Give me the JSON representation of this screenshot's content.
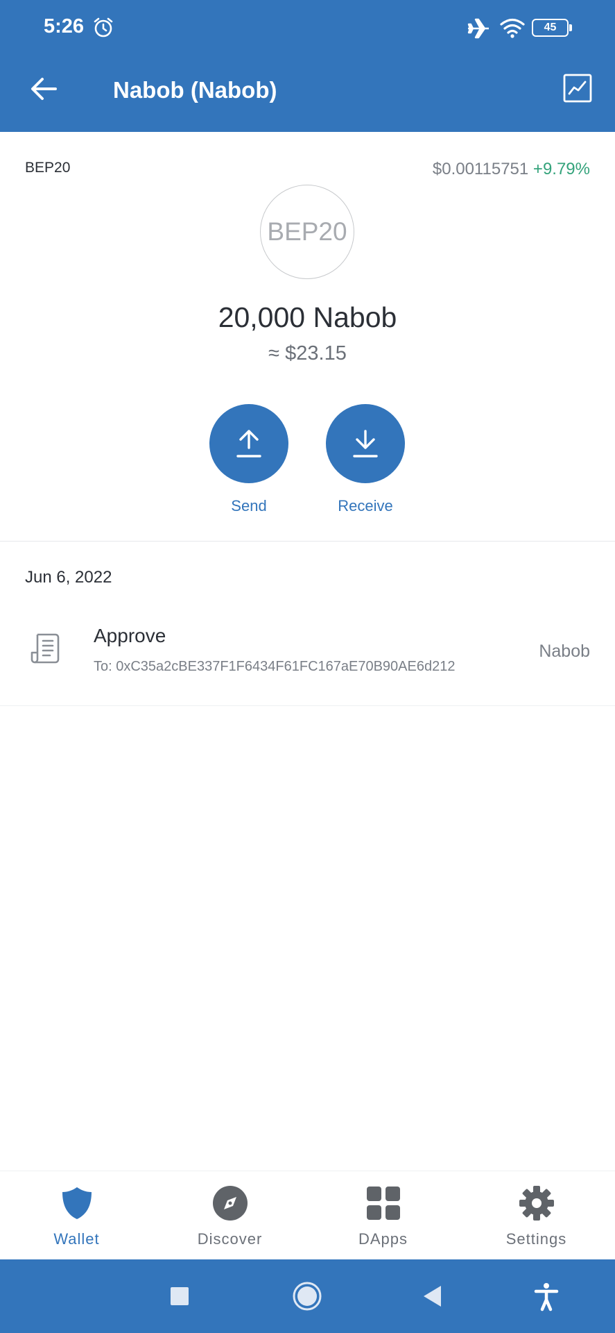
{
  "status_bar": {
    "time": "5:26",
    "battery": "45"
  },
  "app_bar": {
    "title": "Nabob (Nabob)"
  },
  "token": {
    "network": "BEP20",
    "price": "$0.00115751",
    "change": "+9.79%",
    "logo_text": "BEP20",
    "balance": "20,000 Nabob",
    "fiat_balance": "≈ $23.15"
  },
  "actions": {
    "send_label": "Send",
    "receive_label": "Receive"
  },
  "transactions": {
    "date": "Jun 6, 2022",
    "items": [
      {
        "title": "Approve",
        "subtitle": "To: 0xC35a2cBE337F1F6434F61FC167aE70B90AE6d212",
        "amount": "Nabob"
      }
    ]
  },
  "bottom_nav": {
    "items": [
      {
        "label": "Wallet",
        "icon": "shield-icon",
        "active": true
      },
      {
        "label": "Discover",
        "icon": "compass-icon",
        "active": false
      },
      {
        "label": "DApps",
        "icon": "grid-icon",
        "active": false
      },
      {
        "label": "Settings",
        "icon": "gear-icon",
        "active": false
      }
    ]
  },
  "colors": {
    "brand": "#3375bb",
    "positive": "#34a37b"
  }
}
